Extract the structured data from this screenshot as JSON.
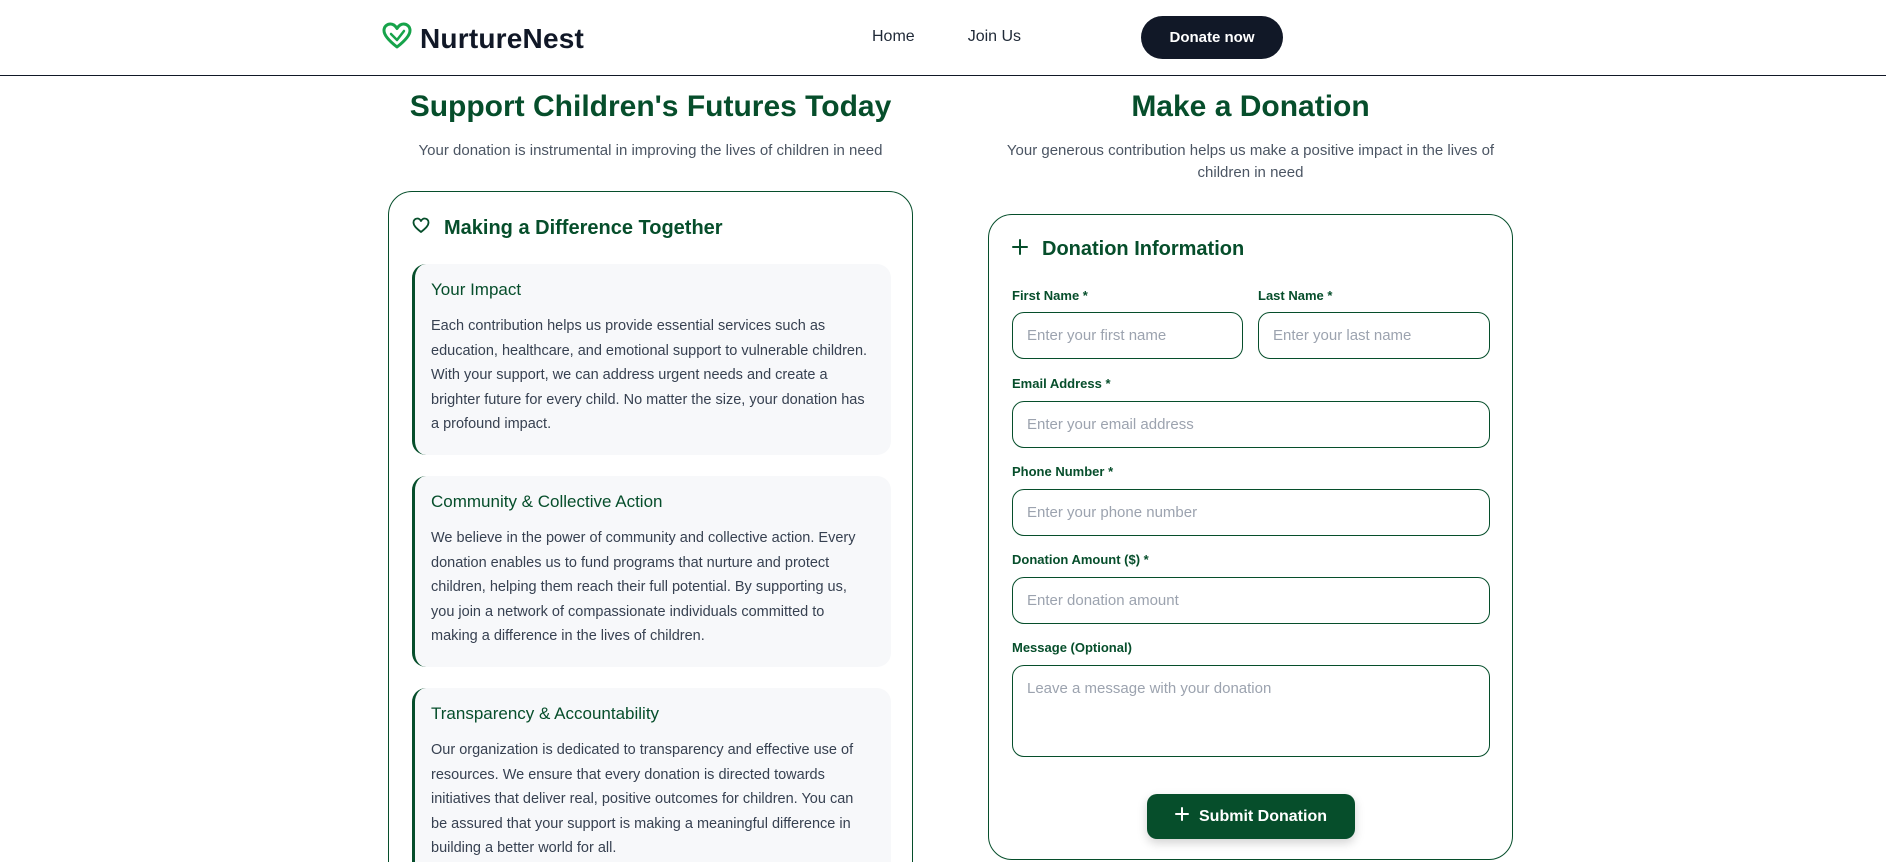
{
  "header": {
    "brand": "NurtureNest",
    "nav": [
      "Home",
      "Join Us"
    ],
    "donate_label": "Donate now"
  },
  "left": {
    "title": "Support Children's Futures Today",
    "subtitle": "Your donation is instrumental in improving the lives of children in need",
    "card_heading": "Making a Difference Together",
    "boxes": [
      {
        "title": "Your Impact",
        "text": "Each contribution helps us provide essential services such as education, healthcare, and emotional support to vulnerable children. With your support, we can address urgent needs and create a brighter future for every child. No matter the size, your donation has a profound impact."
      },
      {
        "title": "Community & Collective Action",
        "text": "We believe in the power of community and collective action. Every donation enables us to fund programs that nurture and protect children, helping them reach their full potential. By supporting us, you join a network of compassionate individuals committed to making a difference in the lives of children."
      },
      {
        "title": "Transparency & Accountability",
        "text": "Our organization is dedicated to transparency and effective use of resources. We ensure that every donation is directed towards initiatives that deliver real, positive outcomes for children. You can be assured that your support is making a meaningful difference in building a better world for all."
      }
    ]
  },
  "right": {
    "title": "Make a Donation",
    "subtitle": "Your generous contribution helps us make a positive impact in the lives of children in need",
    "card_heading": "Donation Information",
    "form": {
      "first_name_label": "First Name *",
      "first_name_placeholder": "Enter your first name",
      "last_name_label": "Last Name *",
      "last_name_placeholder": "Enter your last name",
      "email_label": "Email Address *",
      "email_placeholder": "Enter your email address",
      "phone_label": "Phone Number *",
      "phone_placeholder": "Enter your phone number",
      "amount_label": "Donation Amount ($) *",
      "amount_placeholder": "Enter donation amount",
      "message_label": "Message (Optional)",
      "message_placeholder": "Leave a message with your donation",
      "submit_label": "Submit Donation"
    }
  },
  "icons": {
    "logo": "heart-logo-icon",
    "card_left": "heart-outline-icon",
    "card_right": "plus-icon",
    "submit": "plus-icon"
  },
  "colors": {
    "brand_green": "#064e2b",
    "dark": "#111827",
    "logo_green": "#16a34a"
  }
}
